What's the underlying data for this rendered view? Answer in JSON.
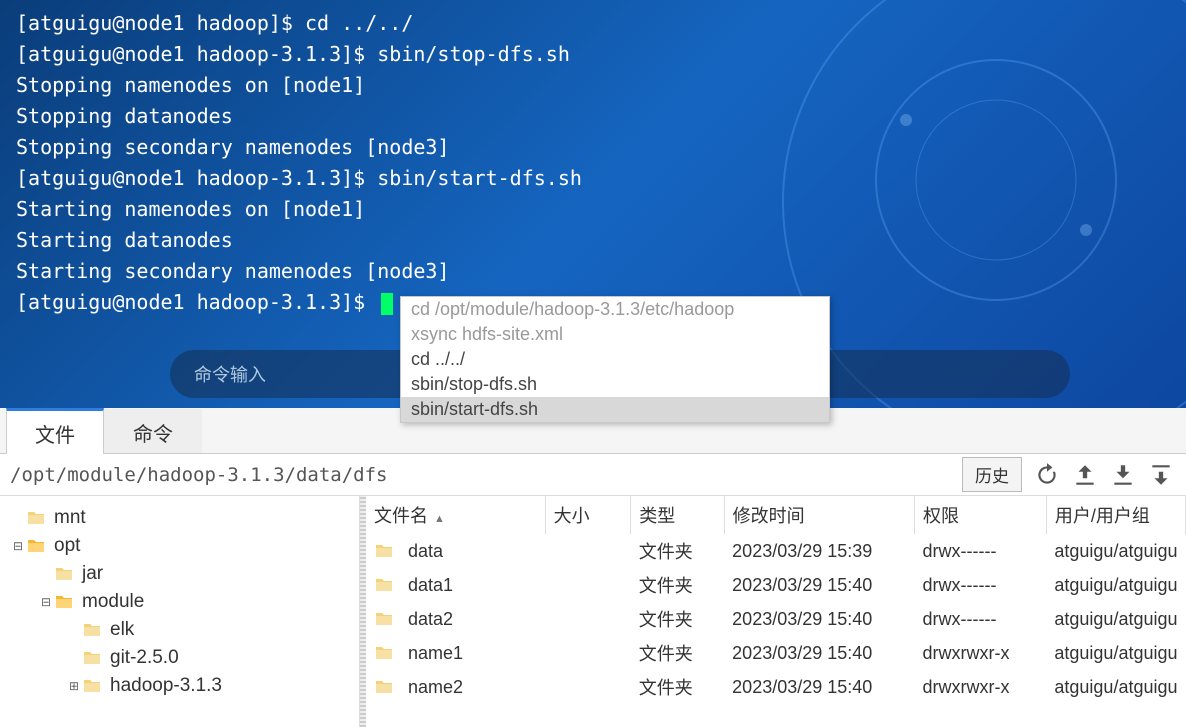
{
  "terminal": {
    "lines": [
      "[atguigu@node1 hadoop]$ cd ../../",
      "[atguigu@node1 hadoop-3.1.3]$ sbin/stop-dfs.sh",
      "Stopping namenodes on [node1]",
      "Stopping datanodes",
      "Stopping secondary namenodes [node3]",
      "[atguigu@node1 hadoop-3.1.3]$ sbin/start-dfs.sh",
      "Starting namenodes on [node1]",
      "Starting datanodes",
      "Starting secondary namenodes [node3]",
      "[atguigu@node1 hadoop-3.1.3]$ "
    ],
    "cmd_placeholder": "命令输入"
  },
  "autocomplete": {
    "items": [
      {
        "text": "cd /opt/module/hadoop-3.1.3/etc/hadoop",
        "state": "dim"
      },
      {
        "text": "xsync hdfs-site.xml",
        "state": "dim"
      },
      {
        "text": "cd ../../",
        "state": ""
      },
      {
        "text": "sbin/stop-dfs.sh",
        "state": ""
      },
      {
        "text": "sbin/start-dfs.sh",
        "state": "sel"
      }
    ]
  },
  "tabs": {
    "file": "文件",
    "cmd": "命令"
  },
  "path": {
    "value": "/opt/module/hadoop-3.1.3/data/dfs",
    "history": "历史"
  },
  "file_headers": {
    "name": "文件名",
    "size": "大小",
    "type": "类型",
    "mtime": "修改时间",
    "perm": "权限",
    "owner": "用户/用户组"
  },
  "tree": [
    {
      "indent": 0,
      "toggle": "",
      "icon": "closed",
      "label": "mnt"
    },
    {
      "indent": 0,
      "toggle": "⊟",
      "icon": "open",
      "label": "opt"
    },
    {
      "indent": 1,
      "toggle": "",
      "icon": "closed",
      "label": "jar"
    },
    {
      "indent": 1,
      "toggle": "⊟",
      "icon": "open",
      "label": "module"
    },
    {
      "indent": 2,
      "toggle": "",
      "icon": "closed",
      "label": "elk"
    },
    {
      "indent": 2,
      "toggle": "",
      "icon": "closed",
      "label": "git-2.5.0"
    },
    {
      "indent": 2,
      "toggle": "⊞",
      "icon": "closed",
      "label": "hadoop-3.1.3"
    }
  ],
  "files": [
    {
      "name": "data",
      "size": "",
      "type": "文件夹",
      "mtime": "2023/03/29 15:39",
      "perm": "drwx------",
      "owner": "atguigu/atguigu"
    },
    {
      "name": "data1",
      "size": "",
      "type": "文件夹",
      "mtime": "2023/03/29 15:40",
      "perm": "drwx------",
      "owner": "atguigu/atguigu"
    },
    {
      "name": "data2",
      "size": "",
      "type": "文件夹",
      "mtime": "2023/03/29 15:40",
      "perm": "drwx------",
      "owner": "atguigu/atguigu"
    },
    {
      "name": "name1",
      "size": "",
      "type": "文件夹",
      "mtime": "2023/03/29 15:40",
      "perm": "drwxrwxr-x",
      "owner": "atguigu/atguigu"
    },
    {
      "name": "name2",
      "size": "",
      "type": "文件夹",
      "mtime": "2023/03/29 15:40",
      "perm": "drwxrwxr-x",
      "owner": "atguigu/atguigu"
    }
  ]
}
